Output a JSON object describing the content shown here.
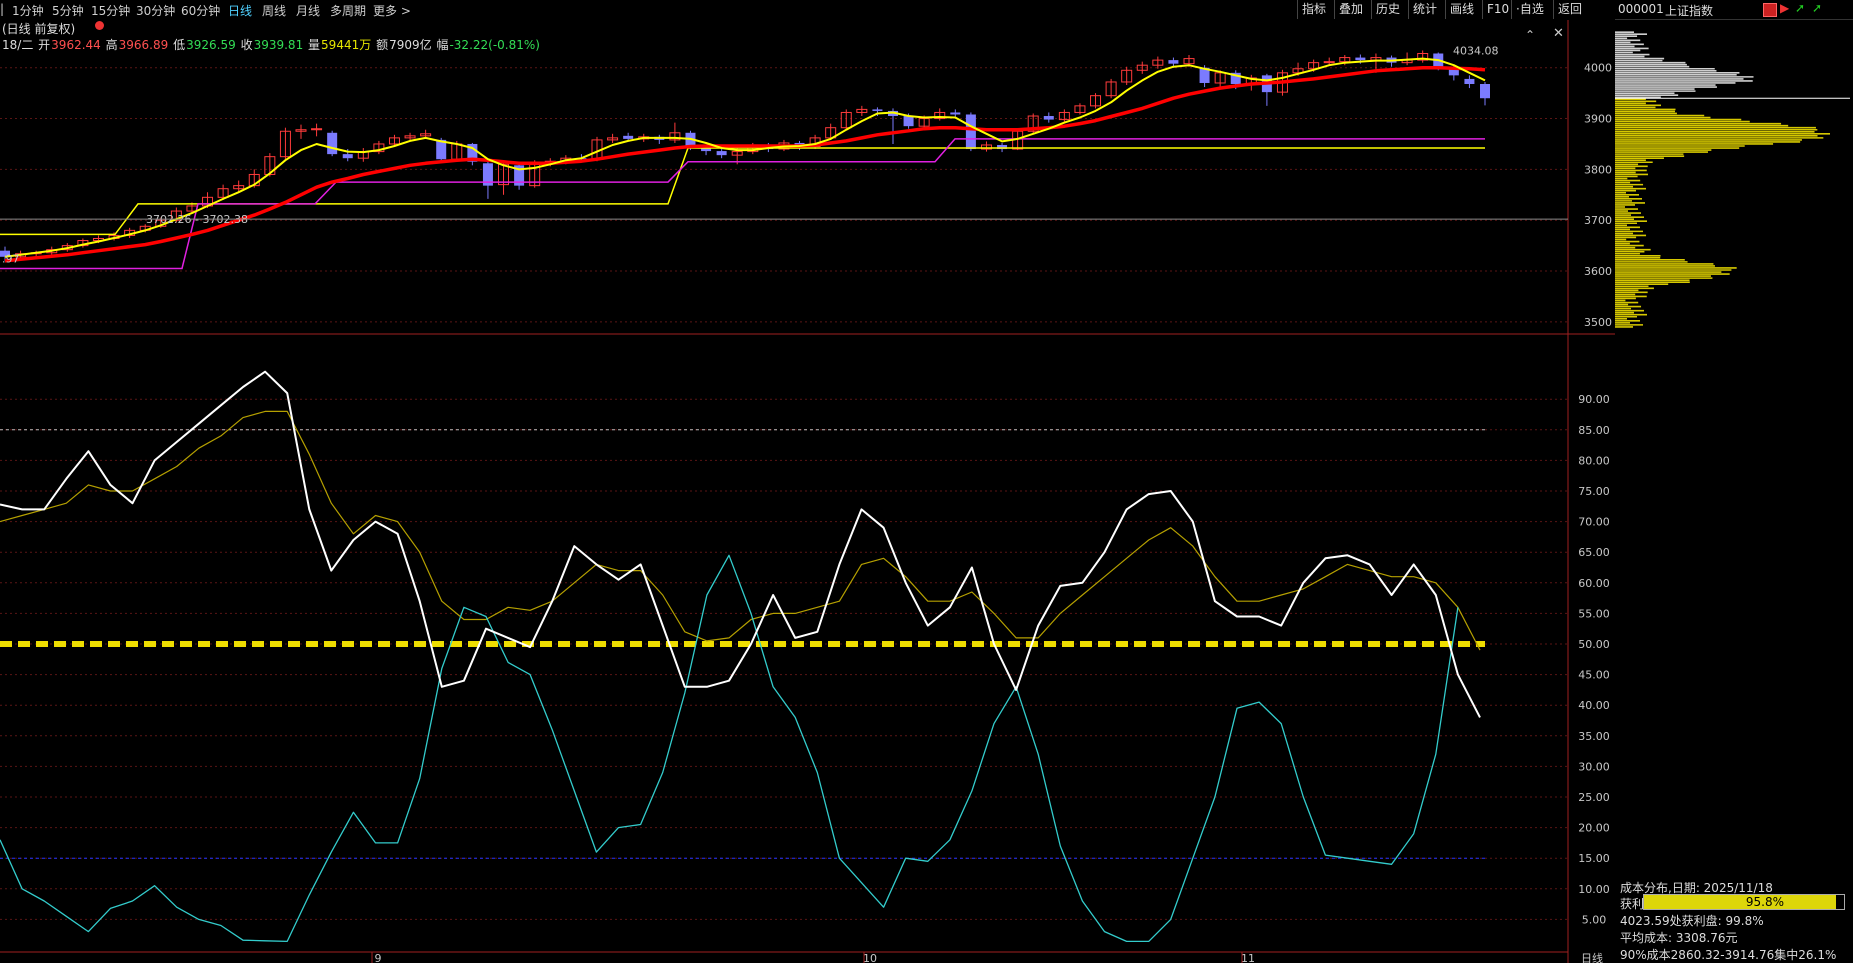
{
  "toolbar": {
    "timeframes": [
      "1分钟",
      "5分钟",
      "15分钟",
      "30分钟",
      "60分钟",
      "日线",
      "周线",
      "月线",
      "多周期",
      "更多"
    ],
    "active_timeframe": "日线",
    "right_buttons": [
      "指标",
      "叠加",
      "历史",
      "统计",
      "画线",
      "F10",
      "·自选",
      "返回"
    ]
  },
  "symbol": {
    "code": "000001",
    "name": "上证指数"
  },
  "chart_title": "(日线 前复权)",
  "info": {
    "date": "18/二",
    "open_label": "开",
    "open": "3962.44",
    "high_label": "高",
    "high": "3966.89",
    "low_label": "低",
    "low": "3926.59",
    "close_label": "收",
    "close": "3939.81",
    "volume_label": "量",
    "volume": "59441万",
    "amount_label": "额",
    "amount": "7909亿",
    "change_label": "幅",
    "change": "-32.22(-0.81%)"
  },
  "price_annotations": {
    "high_mark": "4034.08",
    "left_mark": "3702.26 - 3702.38",
    "left_cut": ".97"
  },
  "price_axis": [
    "4000",
    "3900",
    "3800",
    "3700",
    "3600",
    "3500"
  ],
  "osc_axis": [
    "90.00",
    "85.00",
    "80.00",
    "75.00",
    "70.00",
    "65.00",
    "60.00",
    "55.00",
    "50.00",
    "45.00",
    "40.00",
    "35.00",
    "30.00",
    "25.00",
    "20.00",
    "15.00",
    "10.00",
    "5.00"
  ],
  "bottom_axis": {
    "months": [
      "9",
      "10",
      "11"
    ],
    "period": "日线"
  },
  "cost_panel": {
    "title": "成本分布,日期: 2025/11/18",
    "profit_label": "获利比例:",
    "profit_value": "95.8%",
    "profit_ratio": 0.958,
    "line3": "4023.59处获利盘: 99.8%",
    "line4": "平均成本: 3308.76元",
    "line5": "90%成本2860.32-3914.76集中26.1%"
  },
  "chart_data": [
    {
      "type": "line",
      "panel": "price (K-line with MA)",
      "y_range": [
        3480,
        4090
      ],
      "candles": [
        {
          "o": 3640,
          "c": 3628,
          "h": 3648,
          "l": 3620
        },
        {
          "o": 3628,
          "c": 3634,
          "h": 3640,
          "l": 3622
        },
        {
          "o": 3634,
          "c": 3636,
          "h": 3640,
          "l": 3628
        },
        {
          "o": 3636,
          "c": 3642,
          "h": 3648,
          "l": 3632
        },
        {
          "o": 3642,
          "c": 3650,
          "h": 3655,
          "l": 3638
        },
        {
          "o": 3650,
          "c": 3660,
          "h": 3664,
          "l": 3646
        },
        {
          "o": 3660,
          "c": 3664,
          "h": 3670,
          "l": 3655
        },
        {
          "o": 3664,
          "c": 3670,
          "h": 3676,
          "l": 3660
        },
        {
          "o": 3670,
          "c": 3680,
          "h": 3685,
          "l": 3665
        },
        {
          "o": 3680,
          "c": 3688,
          "h": 3692,
          "l": 3676
        },
        {
          "o": 3688,
          "c": 3700,
          "h": 3705,
          "l": 3685
        },
        {
          "o": 3700,
          "c": 3718,
          "h": 3725,
          "l": 3696
        },
        {
          "o": 3718,
          "c": 3728,
          "h": 3735,
          "l": 3714
        },
        {
          "o": 3728,
          "c": 3745,
          "h": 3755,
          "l": 3724
        },
        {
          "o": 3745,
          "c": 3762,
          "h": 3770,
          "l": 3740
        },
        {
          "o": 3762,
          "c": 3768,
          "h": 3778,
          "l": 3755
        },
        {
          "o": 3768,
          "c": 3790,
          "h": 3800,
          "l": 3764
        },
        {
          "o": 3790,
          "c": 3825,
          "h": 3832,
          "l": 3786
        },
        {
          "o": 3825,
          "c": 3875,
          "h": 3882,
          "l": 3820
        },
        {
          "o": 3875,
          "c": 3878,
          "h": 3888,
          "l": 3860
        },
        {
          "o": 3878,
          "c": 3880,
          "h": 3890,
          "l": 3865
        },
        {
          "o": 3872,
          "c": 3830,
          "h": 3876,
          "l": 3826
        },
        {
          "o": 3830,
          "c": 3822,
          "h": 3840,
          "l": 3816
        },
        {
          "o": 3822,
          "c": 3835,
          "h": 3842,
          "l": 3815
        },
        {
          "o": 3835,
          "c": 3850,
          "h": 3856,
          "l": 3830
        },
        {
          "o": 3850,
          "c": 3862,
          "h": 3868,
          "l": 3846
        },
        {
          "o": 3862,
          "c": 3866,
          "h": 3872,
          "l": 3856
        },
        {
          "o": 3866,
          "c": 3870,
          "h": 3878,
          "l": 3860
        },
        {
          "o": 3858,
          "c": 3820,
          "h": 3862,
          "l": 3816
        },
        {
          "o": 3820,
          "c": 3850,
          "h": 3856,
          "l": 3815
        },
        {
          "o": 3850,
          "c": 3815,
          "h": 3852,
          "l": 3808
        },
        {
          "o": 3812,
          "c": 3768,
          "h": 3816,
          "l": 3742
        },
        {
          "o": 3770,
          "c": 3810,
          "h": 3815,
          "l": 3750
        },
        {
          "o": 3808,
          "c": 3768,
          "h": 3812,
          "l": 3760
        },
        {
          "o": 3768,
          "c": 3812,
          "h": 3818,
          "l": 3764
        },
        {
          "o": 3812,
          "c": 3816,
          "h": 3822,
          "l": 3806
        },
        {
          "o": 3816,
          "c": 3822,
          "h": 3828,
          "l": 3810
        },
        {
          "o": 3822,
          "c": 3820,
          "h": 3830,
          "l": 3814
        },
        {
          "o": 3820,
          "c": 3858,
          "h": 3864,
          "l": 3816
        },
        {
          "o": 3858,
          "c": 3862,
          "h": 3870,
          "l": 3852
        },
        {
          "o": 3866,
          "c": 3860,
          "h": 3872,
          "l": 3855
        },
        {
          "o": 3860,
          "c": 3864,
          "h": 3870,
          "l": 3854
        },
        {
          "o": 3864,
          "c": 3858,
          "h": 3868,
          "l": 3850
        },
        {
          "o": 3858,
          "c": 3872,
          "h": 3892,
          "l": 3852
        },
        {
          "o": 3872,
          "c": 3842,
          "h": 3876,
          "l": 3838
        },
        {
          "o": 3842,
          "c": 3836,
          "h": 3848,
          "l": 3828
        },
        {
          "o": 3836,
          "c": 3828,
          "h": 3840,
          "l": 3822
        },
        {
          "o": 3828,
          "c": 3835,
          "h": 3842,
          "l": 3810
        },
        {
          "o": 3835,
          "c": 3848,
          "h": 3852,
          "l": 3830
        },
        {
          "o": 3848,
          "c": 3840,
          "h": 3852,
          "l": 3834
        },
        {
          "o": 3840,
          "c": 3852,
          "h": 3858,
          "l": 3836
        },
        {
          "o": 3852,
          "c": 3845,
          "h": 3856,
          "l": 3838
        },
        {
          "o": 3845,
          "c": 3862,
          "h": 3868,
          "l": 3840
        },
        {
          "o": 3862,
          "c": 3882,
          "h": 3890,
          "l": 3858
        },
        {
          "o": 3882,
          "c": 3912,
          "h": 3918,
          "l": 3878
        },
        {
          "o": 3912,
          "c": 3918,
          "h": 3925,
          "l": 3905
        },
        {
          "o": 3918,
          "c": 3915,
          "h": 3922,
          "l": 3905
        },
        {
          "o": 3915,
          "c": 3905,
          "h": 3920,
          "l": 3850
        },
        {
          "o": 3905,
          "c": 3885,
          "h": 3910,
          "l": 3880
        },
        {
          "o": 3885,
          "c": 3900,
          "h": 3906,
          "l": 3880
        },
        {
          "o": 3900,
          "c": 3912,
          "h": 3920,
          "l": 3896
        },
        {
          "o": 3912,
          "c": 3908,
          "h": 3918,
          "l": 3904
        },
        {
          "o": 3908,
          "c": 3840,
          "h": 3912,
          "l": 3836
        },
        {
          "o": 3840,
          "c": 3848,
          "h": 3855,
          "l": 3835
        },
        {
          "o": 3848,
          "c": 3840,
          "h": 3852,
          "l": 3834
        },
        {
          "o": 3840,
          "c": 3875,
          "h": 3880,
          "l": 3838
        },
        {
          "o": 3875,
          "c": 3905,
          "h": 3910,
          "l": 3870
        },
        {
          "o": 3905,
          "c": 3898,
          "h": 3912,
          "l": 3892
        },
        {
          "o": 3898,
          "c": 3912,
          "h": 3918,
          "l": 3894
        },
        {
          "o": 3912,
          "c": 3925,
          "h": 3930,
          "l": 3908
        },
        {
          "o": 3925,
          "c": 3945,
          "h": 3950,
          "l": 3920
        },
        {
          "o": 3945,
          "c": 3972,
          "h": 3978,
          "l": 3940
        },
        {
          "o": 3972,
          "c": 3995,
          "h": 4002,
          "l": 3966
        },
        {
          "o": 3995,
          "c": 4005,
          "h": 4012,
          "l": 3988
        },
        {
          "o": 4005,
          "c": 4015,
          "h": 4022,
          "l": 3998
        },
        {
          "o": 4015,
          "c": 4008,
          "h": 4020,
          "l": 4000
        },
        {
          "o": 4008,
          "c": 4018,
          "h": 4025,
          "l": 4002
        },
        {
          "o": 4000,
          "c": 3970,
          "h": 4005,
          "l": 3962
        },
        {
          "o": 3970,
          "c": 3990,
          "h": 3995,
          "l": 3960
        },
        {
          "o": 3990,
          "c": 3968,
          "h": 3995,
          "l": 3958
        },
        {
          "o": 3968,
          "c": 3980,
          "h": 3986,
          "l": 3955
        },
        {
          "o": 3985,
          "c": 3952,
          "h": 3988,
          "l": 3925
        },
        {
          "o": 3952,
          "c": 3990,
          "h": 3996,
          "l": 3945
        },
        {
          "o": 3990,
          "c": 3998,
          "h": 4010,
          "l": 3984
        },
        {
          "o": 3998,
          "c": 4010,
          "h": 4016,
          "l": 3992
        },
        {
          "o": 4010,
          "c": 4012,
          "h": 4020,
          "l": 4004
        },
        {
          "o": 4012,
          "c": 4020,
          "h": 4025,
          "l": 4005
        },
        {
          "o": 4020,
          "c": 4015,
          "h": 4026,
          "l": 4008
        },
        {
          "o": 4015,
          "c": 4020,
          "h": 4028,
          "l": 3990
        },
        {
          "o": 4020,
          "c": 4010,
          "h": 4024,
          "l": 4002
        },
        {
          "o": 4010,
          "c": 4015,
          "h": 4030,
          "l": 4005
        },
        {
          "o": 4015,
          "c": 4028,
          "h": 4034,
          "l": 4010
        },
        {
          "o": 4028,
          "c": 4000,
          "h": 4030,
          "l": 3995
        },
        {
          "o": 4000,
          "c": 3985,
          "h": 4005,
          "l": 3975
        },
        {
          "o": 3978,
          "c": 3968,
          "h": 3985,
          "l": 3960
        },
        {
          "o": 3968,
          "c": 3940,
          "h": 3972,
          "l": 3926
        }
      ],
      "ma_short": [
        3628,
        3632,
        3636,
        3640,
        3645,
        3652,
        3658,
        3665,
        3672,
        3680,
        3690,
        3702,
        3714,
        3728,
        3742,
        3755,
        3770,
        3792,
        3818,
        3838,
        3850,
        3842,
        3835,
        3834,
        3838,
        3846,
        3856,
        3862,
        3855,
        3850,
        3842,
        3820,
        3808,
        3800,
        3803,
        3810,
        3818,
        3822,
        3835,
        3848,
        3856,
        3862,
        3862,
        3862,
        3860,
        3852,
        3842,
        3838,
        3838,
        3842,
        3845,
        3846,
        3850,
        3860,
        3878,
        3895,
        3910,
        3912,
        3905,
        3902,
        3903,
        3902,
        3885,
        3870,
        3855,
        3860,
        3870,
        3880,
        3892,
        3902,
        3915,
        3932,
        3955,
        3975,
        3992,
        4002,
        4005,
        3998,
        3992,
        3985,
        3978,
        3975,
        3980,
        3988,
        3996,
        4005,
        4010,
        4012,
        4014,
        4014,
        4016,
        4018,
        4015,
        4005,
        3990,
        3975
      ],
      "ma_long": [
        3620,
        3623,
        3626,
        3629,
        3632,
        3636,
        3640,
        3644,
        3648,
        3652,
        3658,
        3665,
        3672,
        3680,
        3690,
        3700,
        3710,
        3722,
        3735,
        3750,
        3765,
        3775,
        3782,
        3790,
        3796,
        3802,
        3808,
        3812,
        3815,
        3818,
        3820,
        3818,
        3815,
        3812,
        3812,
        3812,
        3814,
        3816,
        3820,
        3825,
        3830,
        3834,
        3838,
        3842,
        3845,
        3846,
        3846,
        3846,
        3846,
        3846,
        3846,
        3846,
        3848,
        3852,
        3856,
        3862,
        3868,
        3872,
        3876,
        3880,
        3882,
        3882,
        3880,
        3878,
        3878,
        3878,
        3880,
        3882,
        3885,
        3890,
        3896,
        3904,
        3912,
        3920,
        3930,
        3940,
        3948,
        3954,
        3960,
        3964,
        3968,
        3970,
        3972,
        3975,
        3978,
        3982,
        3986,
        3990,
        3994,
        3996,
        3998,
        4000,
        4000,
        3999,
        3998,
        3996
      ]
    },
    {
      "type": "line",
      "panel": "oscillator",
      "y_range": [
        0,
        100
      ],
      "series": [
        {
          "values": [
            72.8,
            72,
            72,
            77,
            81.5,
            76,
            73,
            80,
            83,
            86,
            89,
            92,
            94.5,
            91,
            72,
            62,
            67,
            70,
            68,
            57,
            43,
            44,
            52.5,
            51,
            49.5,
            57,
            66,
            63,
            60.5,
            63,
            53,
            43,
            43,
            44,
            50,
            58,
            51,
            52,
            63,
            72,
            69,
            60,
            53,
            56,
            62.5,
            50,
            42.5,
            53,
            59.5,
            60,
            65,
            72,
            74.5,
            75,
            70,
            57,
            54.5,
            54.5,
            53,
            60,
            64,
            64.5,
            63,
            58,
            63,
            58,
            45,
            38
          ]
        },
        {
          "values": [
            70,
            71,
            72,
            73,
            76,
            75,
            75,
            77,
            79,
            82,
            84,
            87,
            88,
            88,
            81,
            73,
            68,
            71,
            70,
            65,
            57,
            54,
            54,
            56,
            55.5,
            57,
            60,
            63,
            62,
            62,
            58,
            52,
            50.5,
            51,
            54,
            55,
            55,
            56,
            57,
            63,
            64,
            61,
            57,
            57,
            58.5,
            55,
            51,
            51,
            55,
            58,
            61,
            64,
            67,
            69,
            66,
            61,
            57,
            57,
            58,
            59,
            61,
            63,
            62,
            61,
            61,
            60,
            56,
            49
          ]
        },
        {
          "values": [
            18,
            10,
            8,
            5.5,
            3,
            6.8,
            8,
            10.5,
            7,
            5,
            4,
            1.6,
            1.5,
            1.4,
            9,
            16,
            22.5,
            17.5,
            17.5,
            28,
            46,
            56,
            54.5,
            47,
            45,
            36,
            26,
            16,
            20,
            20.5,
            29,
            42,
            58,
            64.5,
            55,
            43,
            38,
            29,
            15,
            11,
            7,
            15,
            14.5,
            18,
            26,
            37,
            43,
            32,
            17,
            8,
            3,
            1.4,
            1.4,
            5,
            15,
            25,
            39.5,
            40.5,
            37,
            25,
            15.5,
            15,
            14.5,
            14,
            19,
            32,
            56
          ]
        }
      ]
    },
    {
      "type": "bar",
      "panel": "cost distribution (chip profile)",
      "orientation": "horizontal",
      "y_range": [
        3480,
        4090
      ]
    }
  ],
  "colors": {
    "up": "#ff3b3b",
    "down": "#7b7bff",
    "ma_short": "#ffff00",
    "ma_long": "#ff0000",
    "k": "#ffffff",
    "d": "#c9b500",
    "j": "#3ad0d0",
    "support1": "#ffff00",
    "support2": "#e020e0"
  }
}
